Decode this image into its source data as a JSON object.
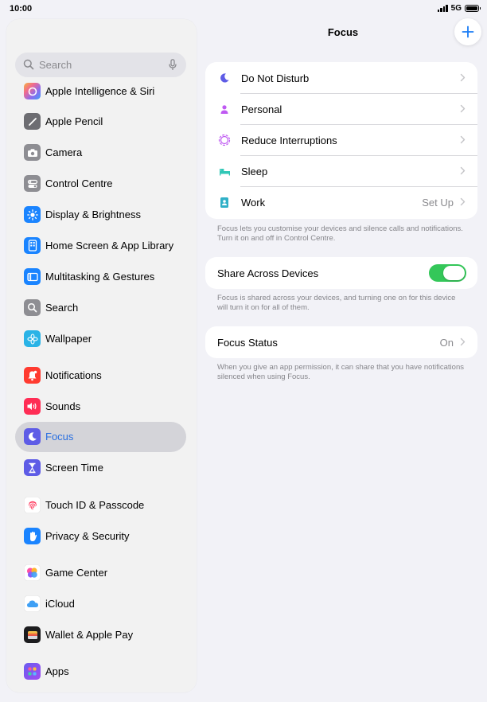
{
  "status_bar": {
    "time": "10:00",
    "network": "5G"
  },
  "sidebar": {
    "search_placeholder": "Search",
    "items": [
      {
        "label": "Apple Intelligence & Siri",
        "icon": "apple-intelligence-icon"
      },
      {
        "label": "Apple Pencil",
        "icon": "pencil-icon"
      },
      {
        "label": "Camera",
        "icon": "camera-icon"
      },
      {
        "label": "Control Centre",
        "icon": "control-centre-icon"
      },
      {
        "label": "Display & Brightness",
        "icon": "sun-icon"
      },
      {
        "label": "Home Screen & App Library",
        "icon": "home-screen-icon"
      },
      {
        "label": "Multitasking & Gestures",
        "icon": "multitasking-icon"
      },
      {
        "label": "Search",
        "icon": "search-icon"
      },
      {
        "label": "Wallpaper",
        "icon": "wallpaper-icon"
      },
      {
        "label": "Notifications",
        "icon": "bell-icon"
      },
      {
        "label": "Sounds",
        "icon": "speaker-icon"
      },
      {
        "label": "Focus",
        "icon": "moon-icon",
        "selected": true
      },
      {
        "label": "Screen Time",
        "icon": "hourglass-icon"
      },
      {
        "label": "Touch ID & Passcode",
        "icon": "fingerprint-icon"
      },
      {
        "label": "Privacy & Security",
        "icon": "hand-icon"
      },
      {
        "label": "Game Center",
        "icon": "game-center-icon"
      },
      {
        "label": "iCloud",
        "icon": "cloud-icon"
      },
      {
        "label": "Wallet & Apple Pay",
        "icon": "wallet-icon"
      },
      {
        "label": "Apps",
        "icon": "apps-grid-icon"
      }
    ]
  },
  "main": {
    "title": "Focus",
    "focus_modes": [
      {
        "label": "Do Not Disturb",
        "value": "",
        "icon": "moon-icon"
      },
      {
        "label": "Personal",
        "value": "",
        "icon": "person-icon"
      },
      {
        "label": "Reduce Interruptions",
        "value": "",
        "icon": "flower-icon"
      },
      {
        "label": "Sleep",
        "value": "",
        "icon": "bed-icon"
      },
      {
        "label": "Work",
        "value": "Set Up",
        "icon": "badge-icon"
      }
    ],
    "focus_footnote": "Focus lets you customise your devices and silence calls and notifications. Turn it on and off in Control Centre.",
    "share": {
      "label": "Share Across Devices",
      "enabled": true
    },
    "share_footnote": "Focus is shared across your devices, and turning one on for this device will turn it on for all of them.",
    "status": {
      "label": "Focus Status",
      "value": "On"
    },
    "status_footnote": "When you give an app permission, it can share that you have notifications silenced when using Focus."
  },
  "colors": {
    "accent": "#2a6fe0",
    "toggle_on": "#34c759",
    "moon": "#5e5ce6",
    "personal": "#bf5af2",
    "sleep": "#30c7b6",
    "work": "#30b0c7"
  }
}
